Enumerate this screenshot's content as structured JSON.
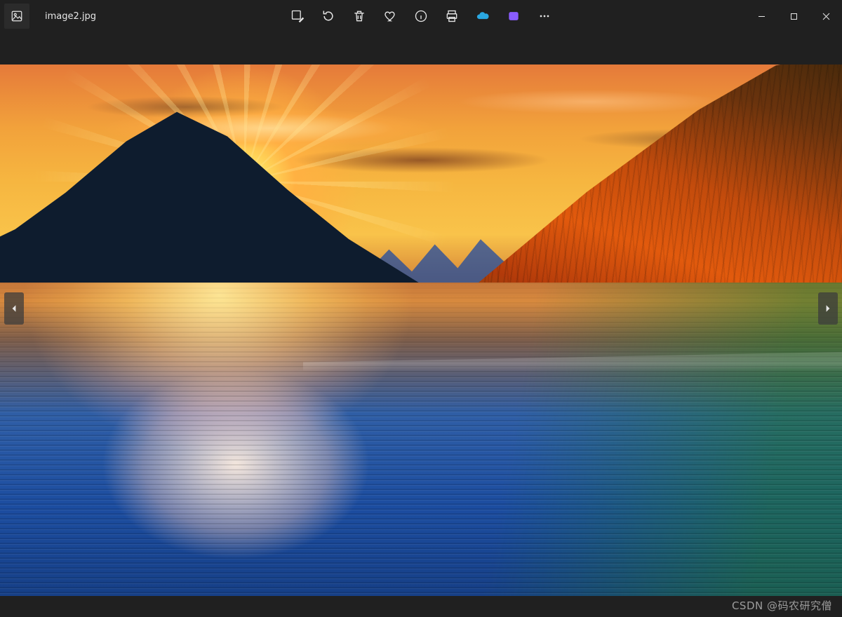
{
  "titlebar": {
    "filename": "image2.jpg"
  },
  "toolbar": {
    "edit": "edit-icon",
    "rotate": "rotate-icon",
    "delete": "trash-icon",
    "favorite": "heart-icon",
    "info": "info-icon",
    "print": "print-icon",
    "onedrive": "onedrive-icon",
    "clipchamp": "clipchamp-icon",
    "more": "more-icon"
  },
  "window": {
    "minimize": "—",
    "maximize": "▢",
    "close": "✕"
  },
  "nav": {
    "prev": "previous",
    "next": "next"
  },
  "watermark": "CSDN @码农研究僧",
  "colors": {
    "onedrive": "#2aa7e1",
    "clipchamp": "#8a5cff"
  },
  "image": {
    "description": "Sunset over a mountain lake; sun cresting a dark peak on the left, orange clouds, autumn-forested slope on the right, reflective rippled water."
  }
}
